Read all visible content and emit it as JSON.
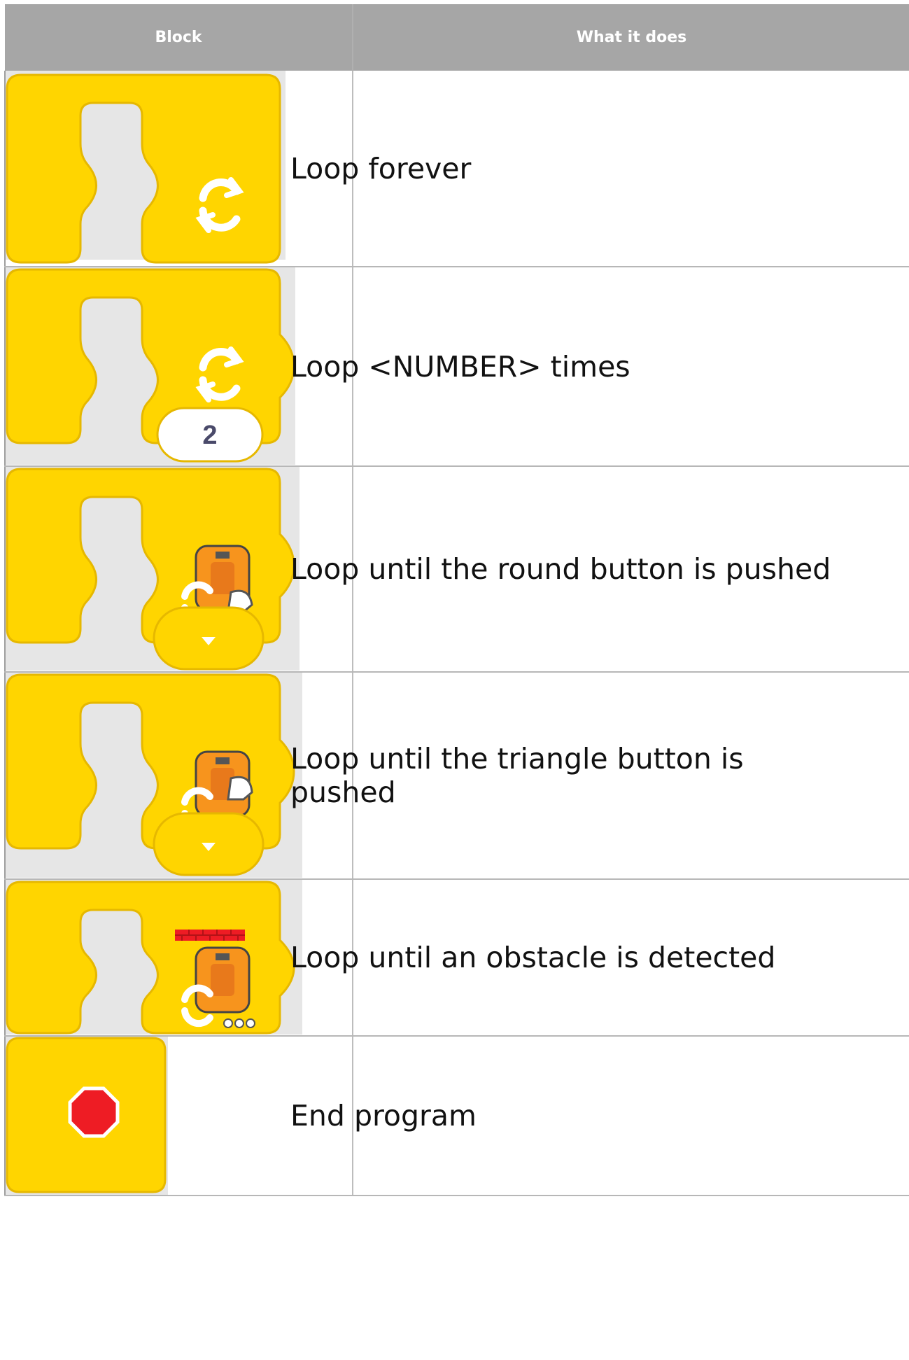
{
  "table": {
    "headers": {
      "block": "Block",
      "description": "What it does"
    },
    "rows": [
      {
        "block_icon": "loop-forever-block-icon",
        "description": "Loop forever"
      },
      {
        "block_icon": "loop-number-times-block-icon",
        "value": "2",
        "description": "Loop <NUMBER> times"
      },
      {
        "block_icon": "loop-until-round-button-block-icon",
        "description": "Loop until the round button is pushed"
      },
      {
        "block_icon": "loop-until-triangle-button-block-icon",
        "description": "Loop until the triangle button is pushed"
      },
      {
        "block_icon": "loop-until-obstacle-block-icon",
        "description": "Loop until an obstacle is detected"
      },
      {
        "block_icon": "end-program-block-icon",
        "description": "End program"
      }
    ]
  },
  "colors": {
    "block_yellow": "#ffd500",
    "block_border": "#e6b800",
    "header_gray": "#a6a6a6",
    "stop_red": "#ee1c24",
    "robot_orange": "#f7941d"
  }
}
